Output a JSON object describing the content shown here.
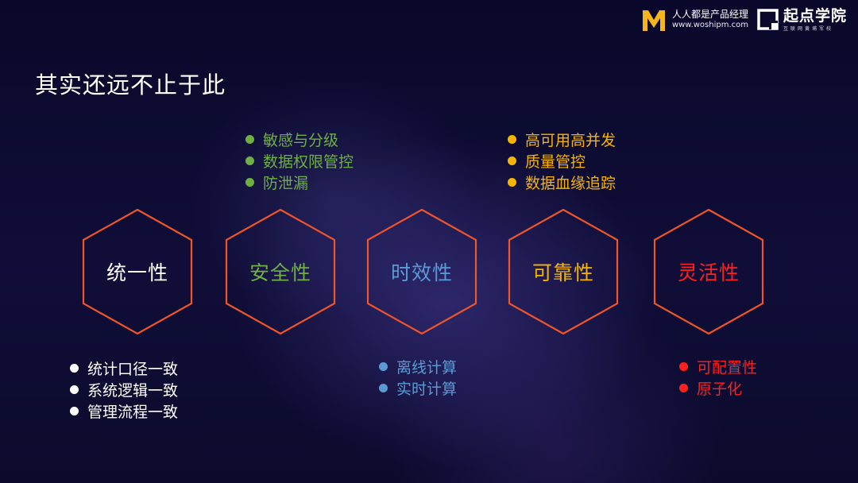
{
  "header": {
    "brand1_name": "人人都是产品经理",
    "brand1_url": "www.woshipm.com",
    "brand2_name": "起点学院",
    "brand2_sub": "互联网黄埔军校"
  },
  "slide": {
    "title": "其实还远不止于此"
  },
  "colors": {
    "hex_stroke": "#f0552a",
    "white": "#ffffff",
    "green": "#6eb043",
    "blue": "#5b9bd5",
    "gold": "#f7b500",
    "red": "#ff1f1f"
  },
  "pillars": [
    {
      "label": "统一性",
      "color": "#ffffff"
    },
    {
      "label": "安全性",
      "color": "#6eb043"
    },
    {
      "label": "时效性",
      "color": "#5b9bd5"
    },
    {
      "label": "可靠性",
      "color": "#f7b500"
    },
    {
      "label": "灵活性",
      "color": "#ff1f1f"
    }
  ],
  "lists": {
    "unity": [
      "统计口径一致",
      "系统逻辑一致",
      "管理流程一致"
    ],
    "security": [
      "敏感与分级",
      "数据权限管控",
      "防泄漏"
    ],
    "timeliness": [
      "离线计算",
      "实时计算"
    ],
    "reliability": [
      "高可用高并发",
      "质量管控",
      "数据血缘追踪"
    ],
    "flexibility": [
      "可配置性",
      "原子化"
    ]
  }
}
